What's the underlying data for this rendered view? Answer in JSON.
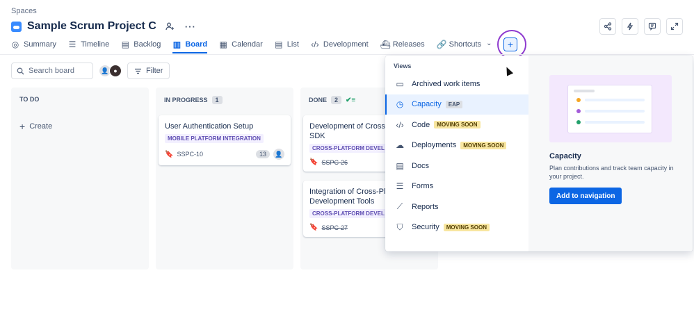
{
  "breadcrumb": "Spaces",
  "project": {
    "title": "Sample Scrum Project C"
  },
  "tabs": [
    {
      "label": "Summary",
      "icon": "globe-icon"
    },
    {
      "label": "Timeline",
      "icon": "timeline-icon"
    },
    {
      "label": "Backlog",
      "icon": "backlog-icon"
    },
    {
      "label": "Board",
      "icon": "board-icon",
      "active": true
    },
    {
      "label": "Calendar",
      "icon": "calendar-icon"
    },
    {
      "label": "List",
      "icon": "list-icon"
    },
    {
      "label": "Development",
      "icon": "code-icon"
    },
    {
      "label": "Releases",
      "icon": "ship-icon"
    },
    {
      "label": "Shortcuts",
      "icon": "link-icon"
    }
  ],
  "toolbar": {
    "search_placeholder": "Search board",
    "filter_label": "Filter"
  },
  "columns": [
    {
      "title": "TO DO",
      "count": "",
      "create_label": "Create"
    },
    {
      "title": "IN PROGRESS",
      "count": "1"
    },
    {
      "title": "DONE",
      "count": "2"
    }
  ],
  "cards": {
    "progress": [
      {
        "title": "User Authentication Setup",
        "label": "MOBILE PLATFORM INTEGRATION",
        "key": "SSPC-10",
        "estimate": "13"
      }
    ],
    "done": [
      {
        "title": "Development of Cross-Platform SDK",
        "label": "CROSS-PLATFORM DEVEL",
        "key": "SSPC-26"
      },
      {
        "title": "Integration of Cross-Platform Development Tools",
        "label": "CROSS-PLATFORM DEVEL",
        "key": "SSPC-27"
      }
    ]
  },
  "views_menu": {
    "heading": "Views",
    "items": [
      {
        "label": "Archived work items",
        "icon": "archive-icon",
        "badge": ""
      },
      {
        "label": "Capacity",
        "icon": "clock-icon",
        "badge": "EAP",
        "selected": true
      },
      {
        "label": "Code",
        "icon": "code-icon",
        "badge": "MOVING SOON"
      },
      {
        "label": "Deployments",
        "icon": "cloud-upload-icon",
        "badge": "MOVING SOON"
      },
      {
        "label": "Docs",
        "icon": "document-icon",
        "badge": ""
      },
      {
        "label": "Forms",
        "icon": "form-icon",
        "badge": ""
      },
      {
        "label": "Reports",
        "icon": "chart-icon",
        "badge": ""
      },
      {
        "label": "Security",
        "icon": "shield-icon",
        "badge": "MOVING SOON"
      }
    ]
  },
  "preview": {
    "title": "Capacity",
    "description": "Plan contributions and track team capacity in your project.",
    "button_label": "Add to navigation"
  },
  "colors": {
    "accent": "#0c66e4",
    "focus_ring": "#8f3bcf",
    "label_purple": "#5e4db2",
    "badge_yellow": "#f8e6a0"
  }
}
